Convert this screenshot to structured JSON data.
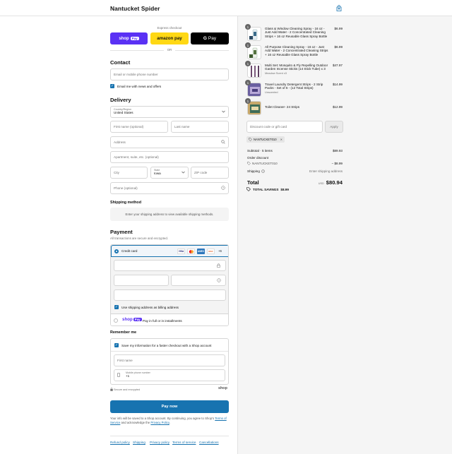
{
  "header": {
    "store_name": "Nantucket Spider",
    "cart_icon": "shopping-bag-icon"
  },
  "express": {
    "label": "Express checkout",
    "shop_pay": {
      "text": "shop",
      "pill": "Pay"
    },
    "amazon_pay": "amazon pay",
    "google_pay": {
      "g": "G",
      "text": "Pay"
    },
    "or": "OR"
  },
  "contact": {
    "title": "Contact",
    "email_placeholder": "Email or mobile phone number",
    "news_label": "Email me with news and offers",
    "news_checked": true
  },
  "delivery": {
    "title": "Delivery",
    "country_label": "Country/Region",
    "country_value": "United States",
    "first_name": "First name (optional)",
    "last_name": "Last name",
    "address": "Address",
    "apartment": "Apartment, suite, etc. (optional)",
    "city": "City",
    "state_label": "State",
    "state_value": "Iowa",
    "zip": "ZIP code",
    "phone": "Phone (optional)"
  },
  "shipping_method": {
    "title": "Shipping method",
    "notice": "Enter your shipping address to view available shipping methods."
  },
  "payment": {
    "title": "Payment",
    "subtitle": "All transactions are secure and encrypted.",
    "credit_card_label": "Credit card",
    "card_brands": [
      "VISA",
      "MC",
      "AMEX",
      "DISC"
    ],
    "more_brands": "+6",
    "billing_label": "Use shipping address as billing address",
    "billing_checked": true,
    "shoppay_option": {
      "text": "shop",
      "pill": "Pay",
      "label": "Pay in full or in installments"
    }
  },
  "remember": {
    "title": "Remember me",
    "save_label": "Save my information for a faster checkout with a Shop account",
    "save_checked": true,
    "first_name": "First name",
    "mobile_label": "Mobile phone number",
    "mobile_value": "+1",
    "secure_label": "Secure and encrypted",
    "shop_logo": "shop"
  },
  "pay_button": "Pay now",
  "legal": {
    "text1": "Your info will be saved to a Shop account. By continuing, you agree to Shop's",
    "terms": "Terms of Service",
    "text2": "and acknowledge the",
    "privacy": "Privacy Policy",
    "end": "."
  },
  "footer_links": [
    "Refund policy",
    "Shipping",
    "Privacy policy",
    "Terms of service",
    "Cancellations"
  ],
  "cart": {
    "items": [
      {
        "qty": "1",
        "name": "Glass & Window Cleaning Spray - 16 oz - Just Add Water - 2 Concentrated Cleaning Strips + 16 oz Reusable Glass Spray Bottle",
        "variant": "",
        "price": "$6.99"
      },
      {
        "qty": "1",
        "name": "All Purpose Cleaning Spray - 16 oz - Just Add Water - 2 Concentrated Cleaning Strips + 16 oz Reusable Glass Spray Bottle",
        "variant": "",
        "price": "$6.99"
      },
      {
        "qty": "1",
        "name": "Multi Set: Mosquito & Fly Repelling Outdoor Garden Incense Sticks (14 Stick Tube) x 3",
        "variant": "Meadow Scent x3",
        "price": "$47.97"
      },
      {
        "qty": "1",
        "name": "Travel Laundry Detergent Strips - 2 Strip Packs - Set of 6 - (12 Total Strips)",
        "variant": "Unscented",
        "price": "$14.99"
      },
      {
        "qty": "1",
        "name": "Toilet Cleaner- 24 Strips",
        "variant": "",
        "price": "$12.99"
      }
    ],
    "discount_placeholder": "Discount code or gift card",
    "apply": "Apply",
    "tag": "NANTUCKET010",
    "subtotal_label": "Subtotal · 5 items",
    "subtotal": "$89.93",
    "order_discount_label": "Order discount",
    "code_label": "NANTUCKET010",
    "discount_value": "− $8.99",
    "shipping_label": "Shipping",
    "shipping_value": "Enter shipping address",
    "total_label": "Total",
    "currency": "USD",
    "total": "$80.94",
    "savings_label": "TOTAL SAVINGS",
    "savings": "$8.99"
  }
}
